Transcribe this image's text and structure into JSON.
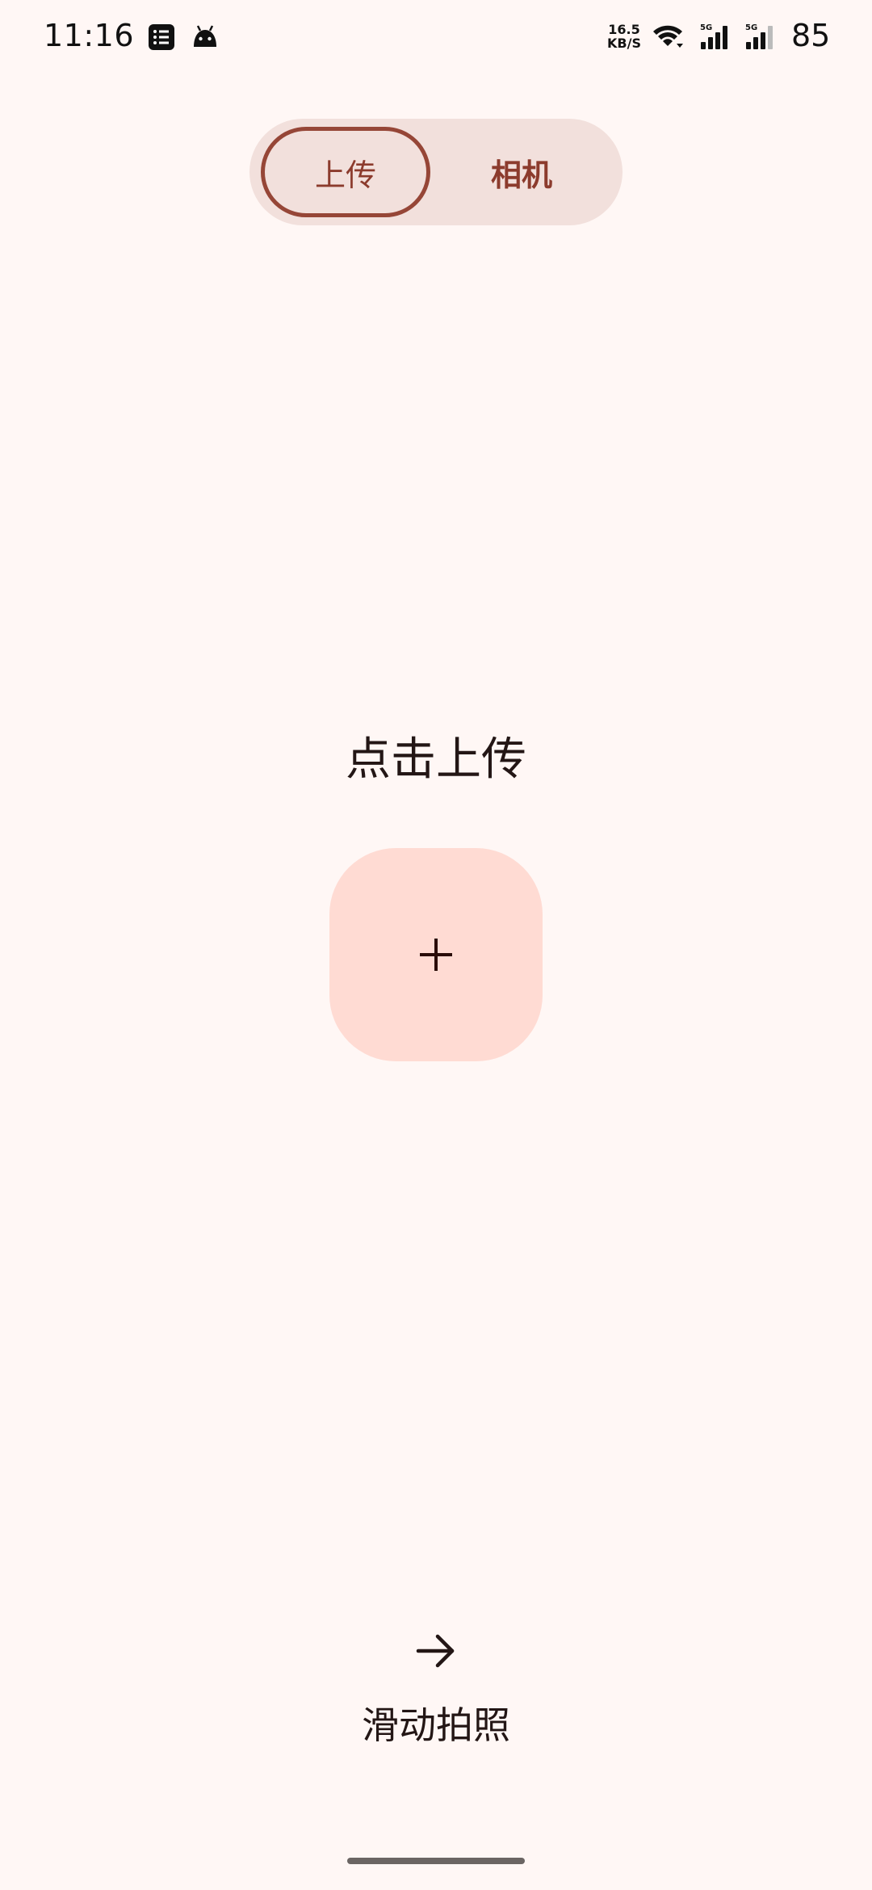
{
  "status_bar": {
    "time": "11:16",
    "net_speed_value": "16.5",
    "net_speed_unit": "KB/S",
    "signal_label_1": "5G",
    "signal_label_2": "5G",
    "battery": "85",
    "icons": [
      "list-notification-icon",
      "android-icon",
      "wifi-icon",
      "signal-icon",
      "signal-icon"
    ]
  },
  "tabs": {
    "options": [
      {
        "label": "上传",
        "selected": true
      },
      {
        "label": "相机",
        "selected": false
      }
    ]
  },
  "main": {
    "upload_label": "点击上传",
    "add_icon": "plus-icon"
  },
  "footer": {
    "swipe_icon": "arrow-right-icon",
    "swipe_label": "滑动拍照"
  },
  "colors": {
    "background": "#fff7f5",
    "segment_bg": "#f2e0dc",
    "accent": "#964637",
    "add_button_bg": "#ffdbd3"
  }
}
